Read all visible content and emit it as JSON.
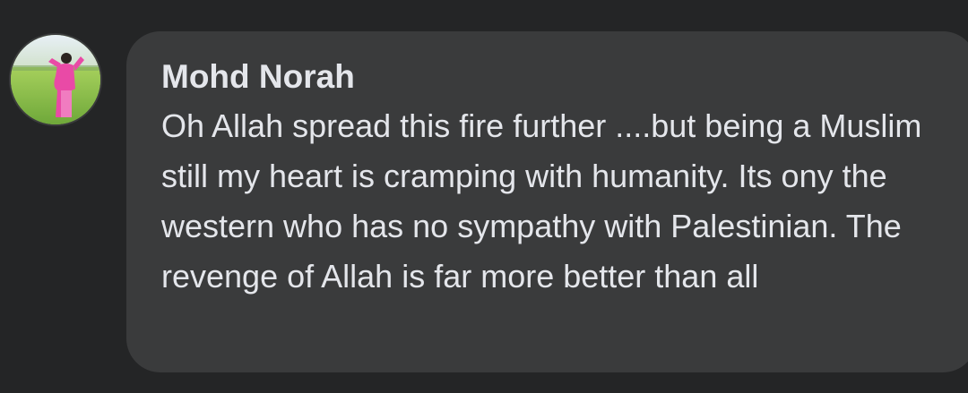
{
  "comment": {
    "author": "Mohd Norah",
    "text": "Oh Allah spread this fire further ....but being a Muslim still my heart is cramping with humanity. Its ony the western who has no sympathy with Palestinian. The revenge of Allah is far more better than all",
    "avatar_icon": "profile-photo-avatar"
  },
  "colors": {
    "background": "#242526",
    "bubble": "#3a3b3c",
    "text": "#e4e6eb"
  }
}
